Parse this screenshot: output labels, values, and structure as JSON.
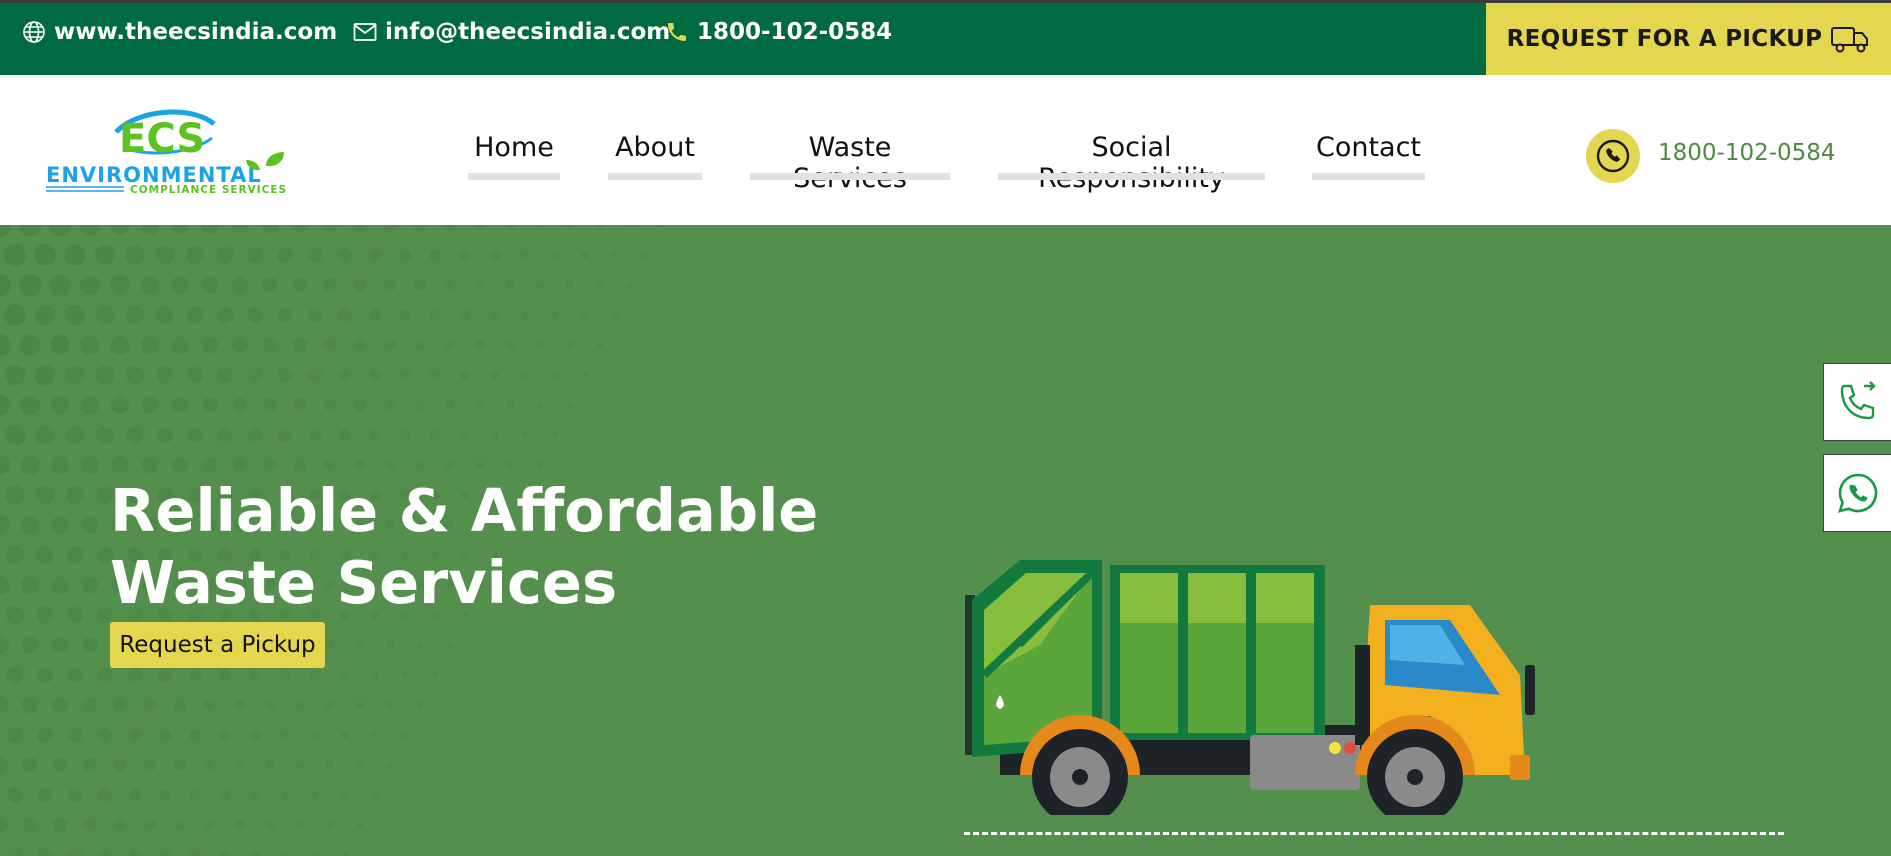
{
  "topbar": {
    "website": "www.theecsindia.com",
    "email": "info@theecsindia.com",
    "phone": "1800-102-0584",
    "pickup_label": "REQUEST FOR A PICKUP"
  },
  "logo": {
    "mark": "ECS",
    "name": "ENVIRONMENTAL",
    "tagline": "COMPLIANCE SERVICES"
  },
  "nav": {
    "items": [
      {
        "label": "Home"
      },
      {
        "label": "About"
      },
      {
        "label": "Waste Services"
      },
      {
        "label": "Social Responsibility"
      },
      {
        "label": "Contact"
      }
    ]
  },
  "header": {
    "phone": "1800-102-0584"
  },
  "hero": {
    "title": "Reliable & Affordable Waste Services",
    "button_label": "Request a Pickup"
  },
  "colors": {
    "topbar_green": "#006b40",
    "accent_yellow": "#e4d64f",
    "hero_green": "#558f4e"
  },
  "icons": [
    "globe-icon",
    "mail-icon",
    "phone-icon",
    "truck-icon",
    "phone-call-icon",
    "whatsapp-icon"
  ]
}
